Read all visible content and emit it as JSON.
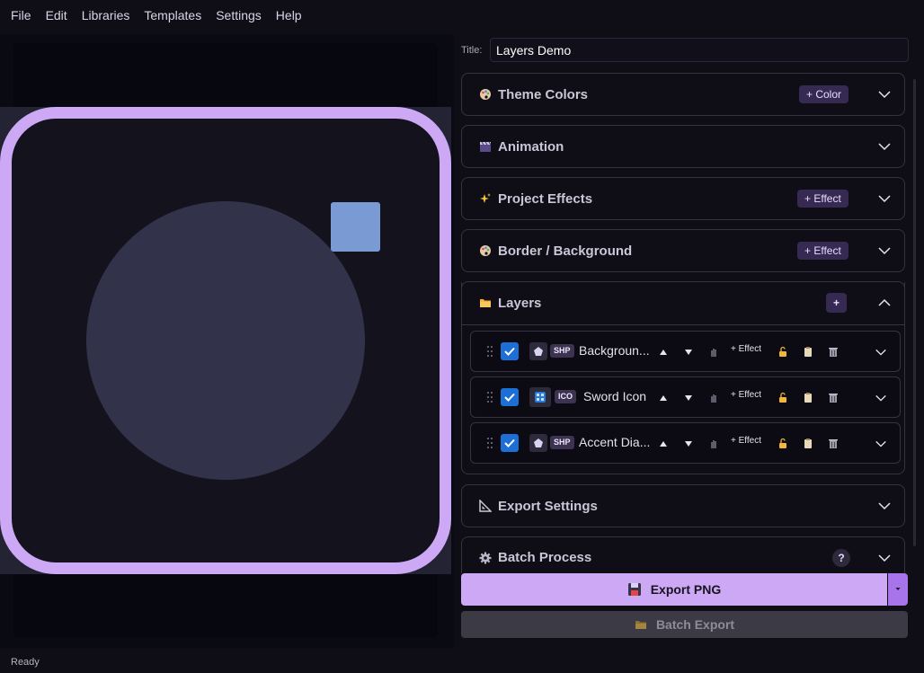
{
  "menu": [
    "File",
    "Edit",
    "Libraries",
    "Templates",
    "Settings",
    "Help"
  ],
  "title_label": "Title:",
  "title_value": "Layers Demo",
  "sections": {
    "theme": {
      "title": "Theme Colors",
      "badge": "+ Color",
      "icon": "palette-icon"
    },
    "animation": {
      "title": "Animation",
      "icon": "clapper-icon"
    },
    "effects": {
      "title": "Project Effects",
      "badge": "+ Effect",
      "icon": "sparkles-icon"
    },
    "border": {
      "title": "Border / Background",
      "badge": "+ Effect",
      "icon": "palette-icon"
    },
    "layers": {
      "title": "Layers",
      "badge": "+",
      "icon": "folder-icon"
    },
    "export": {
      "title": "Export Settings",
      "icon": "triangle-ruler-icon"
    },
    "batch": {
      "title": "Batch Process",
      "badge": "?",
      "icon": "gear-icon"
    }
  },
  "layers": [
    {
      "type": "SHP",
      "name": "Backgroun...",
      "checked": true,
      "effect_label": "+ Effect"
    },
    {
      "type": "ICO",
      "name": "Sword Icon",
      "checked": true,
      "effect_label": "+ Effect"
    },
    {
      "type": "SHP",
      "name": "Accent Dia...",
      "checked": true,
      "effect_label": "+ Effect"
    }
  ],
  "export_label": "Export PNG",
  "batch_export_label": "Batch Export",
  "status": "Ready",
  "colors": {
    "accent": "#cda8f5",
    "accent_dark": "#a774e9",
    "checkbox": "#1d6fd6",
    "badge_bg": "#362a52",
    "preview_square": "#7a9ad4"
  }
}
